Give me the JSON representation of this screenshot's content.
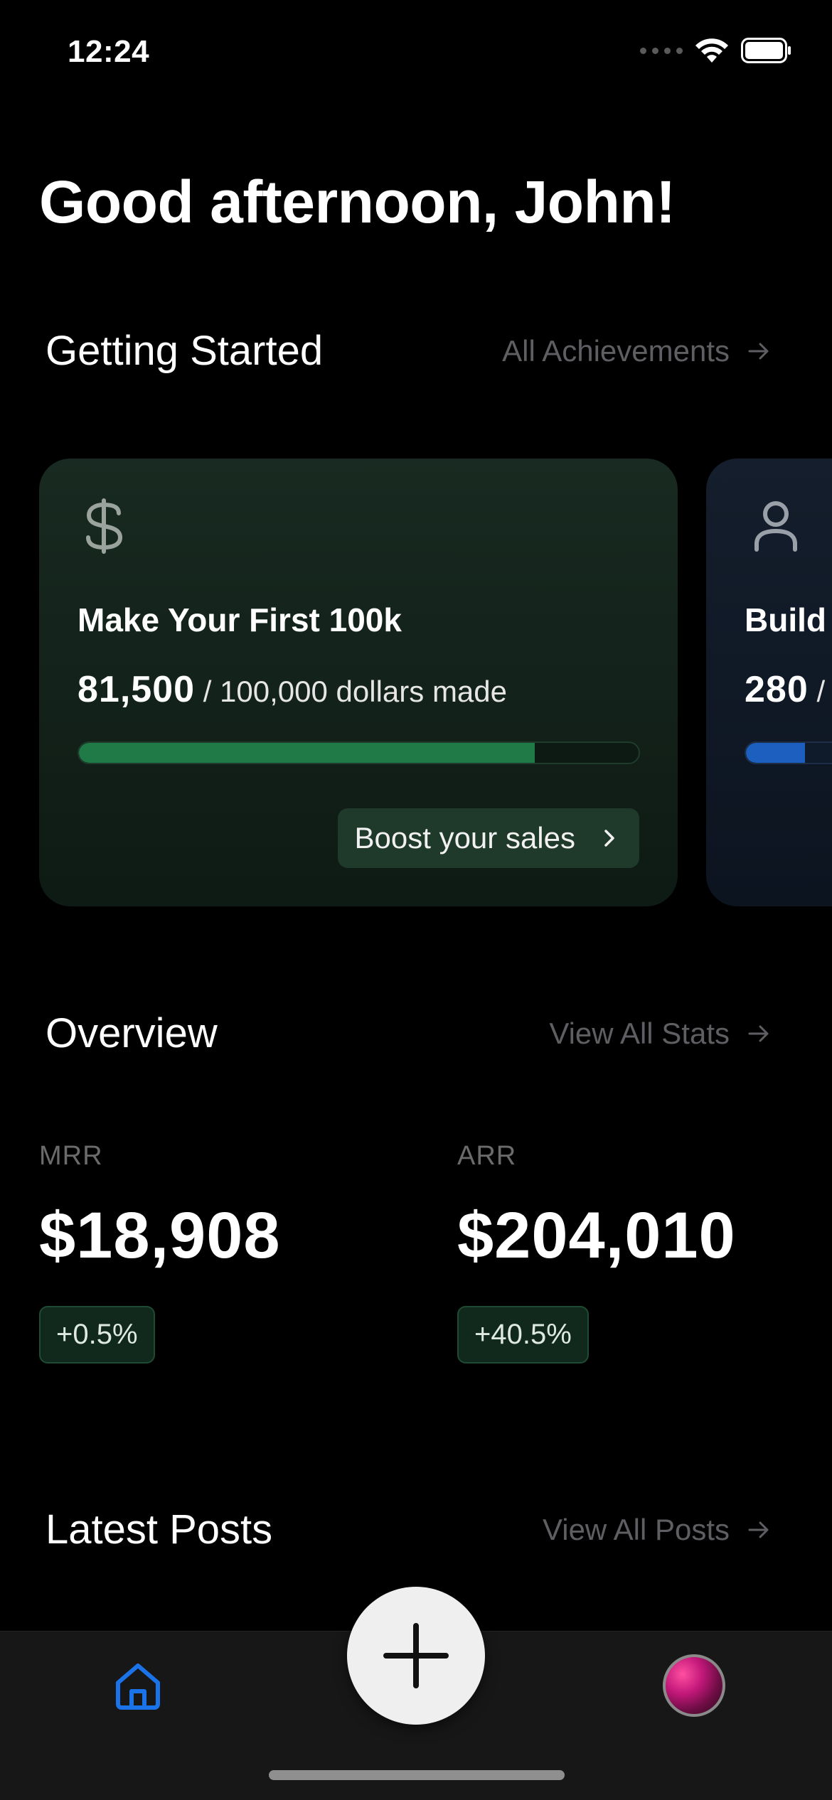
{
  "status_bar": {
    "time": "12:24"
  },
  "greeting": "Good afternoon, John!",
  "getting_started": {
    "title": "Getting Started",
    "link": "All Achievements",
    "cards": [
      {
        "icon": "dollar-icon",
        "title": "Make Your First 100k",
        "current": "81,500",
        "target_text": "/ 100,000 dollars made",
        "progress": 0.815,
        "accent": "#1f7a47",
        "button": "Boost your sales"
      },
      {
        "icon": "person-icon",
        "title": "Build",
        "current": "280",
        "target_text": "/",
        "progress": 0.28,
        "accent": "#1d5fbf"
      }
    ]
  },
  "overview": {
    "title": "Overview",
    "link": "View All Stats",
    "stats": [
      {
        "label": "MRR",
        "value": "$18,908",
        "change": "+0.5%"
      },
      {
        "label": "ARR",
        "value": "$204,010",
        "change": "+40.5%"
      }
    ]
  },
  "latest_posts": {
    "title": "Latest Posts",
    "link": "View All Posts"
  },
  "tab_bar": {
    "items": [
      "home-icon",
      "plus-icon",
      "avatar"
    ],
    "active_color": "#1a73e8"
  }
}
